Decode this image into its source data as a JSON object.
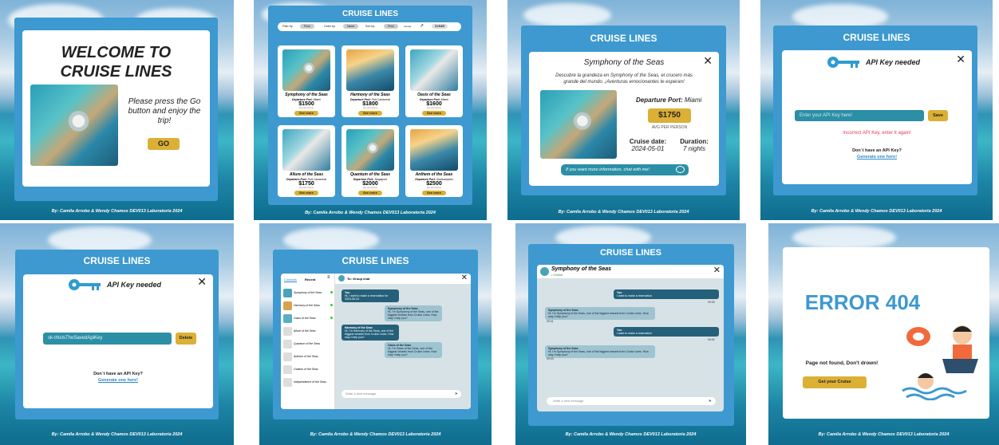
{
  "credit": "By: Camila Arrobo & Wendy Chamos DEV013 Laboratoria 2024",
  "brand_color": "#3d99cf",
  "accent_color": "#dcaf35",
  "welcome": {
    "title_line1": "WELCOME TO",
    "title_line2": "CRUISE LINES",
    "text": "Please press the Go button and enjoy the trip!",
    "go_label": "GO"
  },
  "list": {
    "header": "CRUISE LINES",
    "filter_label": "Filter by:",
    "filter_value": "Price",
    "order_label": "Order by:",
    "order_value": "Name",
    "sort_label": "Sort by:",
    "sort_value": "Price",
    "average_label": "Average",
    "clear_label": "CLEAR",
    "see_more": "See more",
    "cards": [
      {
        "name": "Symphony of the Seas",
        "port_label": "Departure Port:",
        "port": "Miami",
        "price": "$1500",
        "caption": "AVG PER PERSON"
      },
      {
        "name": "Harmony of the Seas",
        "port_label": "Departure Port:",
        "port": "Port Canaveral",
        "price": "$1800",
        "caption": "AVG PER PERSON"
      },
      {
        "name": "Oasis of the Seas",
        "port_label": "Departure Port:",
        "port": "Miami",
        "price": "$1600",
        "caption": "AVG PER PERSON"
      },
      {
        "name": "Allure of the Seas",
        "port_label": "Departure Port:",
        "port": "Port Canaveral",
        "price": "$1750",
        "caption": "AVG PER PERSON"
      },
      {
        "name": "Quantum of the Seas",
        "port_label": "Departure Port:",
        "port": "Singapore",
        "price": "$2000",
        "caption": "AVG PER PERSON"
      },
      {
        "name": "Anthem of the Seas",
        "port_label": "Departure Port:",
        "port": "Southampton",
        "price": "$2500",
        "caption": "AVG PER PERSON"
      }
    ]
  },
  "detail": {
    "header": "CRUISE LINES",
    "title": "Symphony of the Seas",
    "description": "Descubre la grandeza en Symphony of the Seas, el crucero más grande del mundo. ¡Aventuras emocionantes te esperan!",
    "port_label": "Departure Port:",
    "port": "Miami",
    "price": "$1750",
    "price_caption": "AVG PER PERSON",
    "date_label": "Cruise date:",
    "date": "2024-05-01",
    "duration_label": "Duration:",
    "duration": "7 nights",
    "chat_button": "If you want more information, chat with me!"
  },
  "apikey": {
    "header": "CRUISE LINES",
    "title": "API Key needed",
    "placeholder": "Enter your API Key here!",
    "save_label": "Save",
    "error": "Incorrect API Key, enter it again!",
    "no_key": "Don´t have an API Key?",
    "generate": "Generate one here!"
  },
  "apikey_saved": {
    "header": "CRUISE LINES",
    "title": "API Key needed",
    "value": "sk-thisIsTheSavedApiKey",
    "delete_label": "Delete",
    "no_key": "Don´t have an API Key?",
    "generate": "Generate one here!"
  },
  "group_chat": {
    "header": "CRUISE LINES",
    "tab_contacts": "Contacts",
    "tab_recent": "Recent",
    "chat_title": "To: Group chat",
    "contacts": [
      "Symphony of the Seas",
      "Harmony of the Seas",
      "Oasis of the Seas",
      "Allure of the Seas",
      "Quantum of the Seas",
      "Anthem of the Seas",
      "Ovation of the Seas",
      "Independence of the Seas"
    ],
    "messages": [
      {
        "from": "You",
        "text": "Hi, I want to make a reservation for 2024-06-10",
        "side": "right"
      },
      {
        "from": "Symphony of the Seas",
        "text": "Hi, I'm Symphony of the Seas, one of the biggest vessels from Cruise Lines. How may I help you?",
        "side": "right"
      },
      {
        "from": "Harmony of the Seas",
        "text": "Hi, I'm Harmony of the Seas, one of the biggest vessels from Cruise Lines. How may I help you?",
        "side": "left"
      },
      {
        "from": "Oasis of the Seas",
        "text": "Hi, I'm Oasis of the Seas, one of the biggest vessels from Cruise Lines. How may I help you?",
        "side": "right"
      }
    ],
    "placeholder": "Write a new message"
  },
  "single_chat": {
    "header": "CRUISE LINES",
    "name": "Symphony of the Seas",
    "status": "• Online",
    "messages": [
      {
        "from": "You",
        "text": "I want to make a reservation",
        "time": "09:00"
      },
      {
        "from": "Symphony of the Seas",
        "text": "Hi, I'm Symphony of the Seas, one of the biggest vessels from Cruise Lines. How may I help you?",
        "time": "09:01"
      },
      {
        "from": "You",
        "text": "I want to make a reservation",
        "time": "09:02"
      },
      {
        "from": "Symphony of the Seas",
        "text": "Hi, I'm Symphony of the Seas, one of the biggest vessels from Cruise Lines. How may I help you?",
        "time": "09:03"
      }
    ],
    "placeholder": "Write a new message"
  },
  "error404": {
    "title": "ERROR 404",
    "text": "Page not found, Don't drown!",
    "button": "Get your Cruise"
  }
}
